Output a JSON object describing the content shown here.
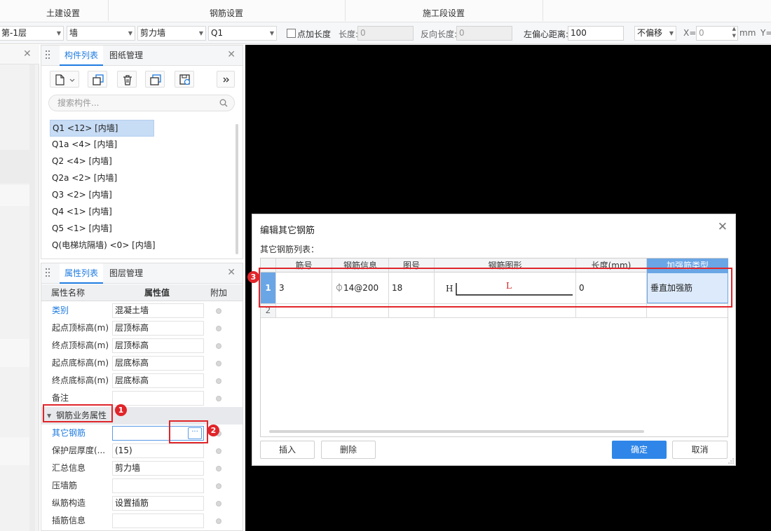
{
  "ribbon": {
    "groups": [
      "土建设置",
      "钢筋设置",
      "施工段设置"
    ]
  },
  "propbar": {
    "floor": "第-1层",
    "type": "墙",
    "subtype": "剪力墙",
    "name": "Q1",
    "add_length_label": "点加长度",
    "length_label": "长度:",
    "length_value": "0",
    "reverse_length_label": "反向长度:",
    "reverse_length_value": "0",
    "left_offset_label": "左偏心距离:",
    "left_offset_value": "100",
    "offset_mode": "不偏移",
    "x_label": "X=",
    "x_value": "0",
    "unit": "mm",
    "y_label": "Y="
  },
  "component_panel": {
    "tabs": [
      "构件列表",
      "图纸管理"
    ],
    "search_placeholder": "搜索构件...",
    "items": [
      "Q1 <12> [内墙]",
      "Q1a <4> [内墙]",
      "Q2 <4> [内墙]",
      "Q2a <2> [内墙]",
      "Q3 <2> [内墙]",
      "Q4 <1> [内墙]",
      "Q5 <1> [内墙]",
      "Q(电梯坑隔墙) <0> [内墙]"
    ]
  },
  "property_panel": {
    "tabs": [
      "属性列表",
      "图层管理"
    ],
    "headers": [
      "属性名称",
      "属性值",
      "附加"
    ],
    "rows": [
      {
        "name": "类别",
        "value": "混凝土墙"
      },
      {
        "name": "起点顶标高(m)",
        "value": "层顶标高"
      },
      {
        "name": "终点顶标高(m)",
        "value": "层顶标高"
      },
      {
        "name": "起点底标高(m)",
        "value": "层底标高"
      },
      {
        "name": "终点底标高(m)",
        "value": "层底标高"
      },
      {
        "name": "备注",
        "value": ""
      }
    ],
    "group_label": "钢筋业务属性",
    "other_rebar_label": "其它钢筋",
    "other_rebar_value": "",
    "rows2": [
      {
        "name": "保护层厚度(...",
        "value": "(15)"
      },
      {
        "name": "汇总信息",
        "value": "剪力墙"
      },
      {
        "name": "压墙筋",
        "value": ""
      },
      {
        "name": "纵筋构造",
        "value": "设置插筋"
      },
      {
        "name": "插筋信息",
        "value": ""
      }
    ],
    "ellipsis": "···"
  },
  "dialog": {
    "title": "编辑其它钢筋",
    "subtitle": "其它钢筋列表：",
    "columns": [
      "筋号",
      "钢筋信息",
      "图号",
      "钢筋图形",
      "长度(mm)",
      "加强筋类型"
    ],
    "rows": [
      {
        "num": "1",
        "bar_no": "3",
        "bar_info": "⏀14@200",
        "fig_no": "18",
        "shape_h": "H",
        "shape_l": "L",
        "length": "0",
        "type": "垂直加强筋"
      },
      {
        "num": "2",
        "bar_no": "",
        "bar_info": "",
        "fig_no": "",
        "shape_h": "",
        "shape_l": "",
        "length": "",
        "type": ""
      }
    ],
    "insert_label": "插入",
    "delete_label": "删除",
    "ok_label": "确定",
    "cancel_label": "取消"
  },
  "annotations": [
    "1",
    "2",
    "3"
  ],
  "colors": {
    "accent": "#1e7be0",
    "annotation": "#e0252a",
    "primary_button": "#2f86e8"
  }
}
